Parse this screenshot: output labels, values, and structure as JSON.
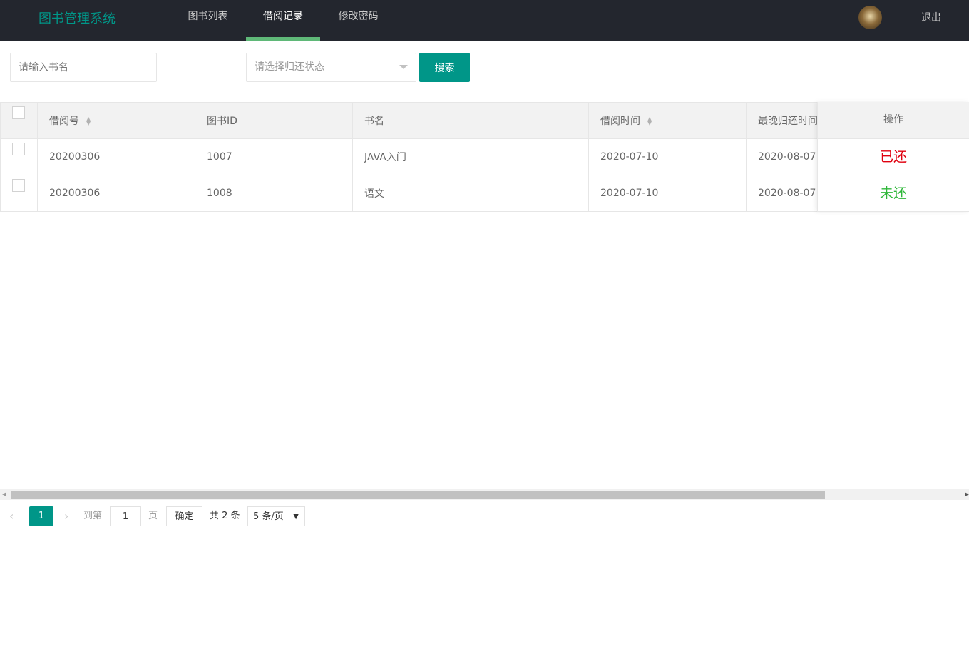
{
  "app": {
    "title": "图书管理系统",
    "logout": "退出"
  },
  "nav": [
    {
      "label": "图书列表"
    },
    {
      "label": "借阅记录",
      "active": true
    },
    {
      "label": "修改密码"
    }
  ],
  "search": {
    "name_placeholder": "请输入书名",
    "status_placeholder": "请选择归还状态",
    "button": "搜索"
  },
  "table": {
    "headers": [
      "借阅号",
      "图书ID",
      "书名",
      "借阅时间",
      "最晚归还时间",
      "操作"
    ],
    "rows": [
      {
        "id": "20200306",
        "book_id": "1007",
        "name": "JAVA入门",
        "borrow": "2020-07-10",
        "due": "2020-08-07",
        "status": "已还",
        "status_color": "#e0000f"
      },
      {
        "id": "20200306",
        "book_id": "1008",
        "name": "语文",
        "borrow": "2020-07-10",
        "due": "2020-08-07",
        "status": "未还",
        "status_color": "#2fb73a"
      }
    ]
  },
  "pagination": {
    "current": "1",
    "goto_label": "到第",
    "goto_value": "1",
    "page_unit": "页",
    "confirm": "确定",
    "total": "共 2 条",
    "page_size": "5 条/页"
  },
  "colors": {
    "header_bg": "#23262e",
    "accent": "#009688",
    "active_tab": "#5fb878"
  }
}
